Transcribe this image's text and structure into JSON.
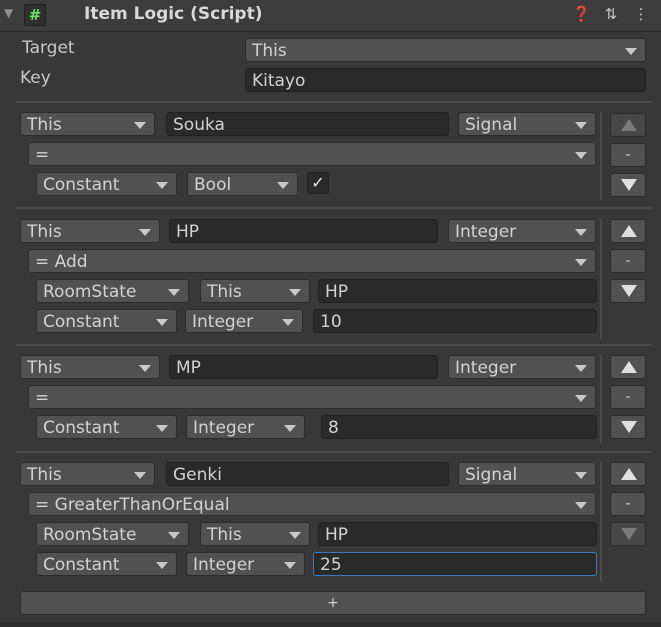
{
  "header": {
    "foldout_glyph": "▼",
    "script_glyph": "#",
    "title": "Item Logic (Script)",
    "help_glyph": "❓",
    "presets_glyph": "⇅",
    "menu_glyph": "⋮"
  },
  "target": {
    "label": "Target",
    "value": "This"
  },
  "key": {
    "label": "Key",
    "value": "Kitayo"
  },
  "side_buttons": {
    "up": "▲",
    "minus": "-",
    "down": "▼"
  },
  "blocks": [
    {
      "source": "This",
      "name": "Souka",
      "type": "Signal",
      "operator": "=",
      "operands": [
        {
          "source": "Constant",
          "type": "Bool",
          "checked": true,
          "check_glyph": "✓"
        }
      ]
    },
    {
      "source": "This",
      "name": "HP",
      "type": "Integer",
      "operator": "= Add",
      "operands": [
        {
          "source": "RoomState",
          "target": "This",
          "value": "HP"
        },
        {
          "source": "Constant",
          "type": "Integer",
          "value": "10"
        }
      ]
    },
    {
      "source": "This",
      "name": "MP",
      "type": "Integer",
      "operator": "=",
      "operands": [
        {
          "source": "Constant",
          "type": "Integer",
          "value": "8"
        }
      ]
    },
    {
      "source": "This",
      "name": "Genki",
      "type": "Signal",
      "operator": "= GreaterThanOrEqual",
      "operands": [
        {
          "source": "RoomState",
          "target": "This",
          "value": "HP"
        },
        {
          "source": "Constant",
          "type": "Integer",
          "value": "25"
        }
      ],
      "down_disabled": true
    }
  ],
  "add_button": {
    "label": "+"
  }
}
